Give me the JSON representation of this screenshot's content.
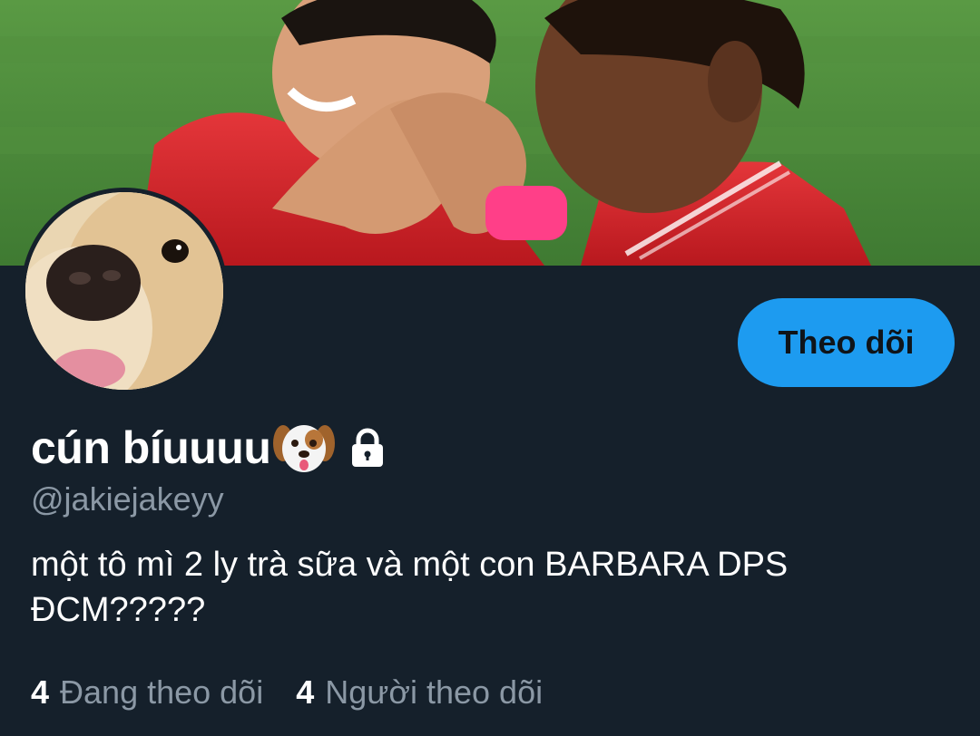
{
  "profile": {
    "display_name": "cún bíuuuu",
    "handle": "@jakiejakeyy",
    "bio_line1": "một tô mì 2 ly trà sữa và một con BARBARA DPS",
    "bio_line2": "ĐCM?????",
    "name_emoji_icon": "dog-face-icon",
    "protected_icon": "lock-icon"
  },
  "actions": {
    "follow_label": "Theo dõi"
  },
  "stats": {
    "following_count": "4",
    "following_label": "Đang theo dõi",
    "followers_count": "4",
    "followers_label": "Người theo dõi"
  },
  "colors": {
    "background": "#15202b",
    "accent": "#1d9bf0",
    "secondary_text": "#8b98a5",
    "primary_text": "#ffffff"
  }
}
